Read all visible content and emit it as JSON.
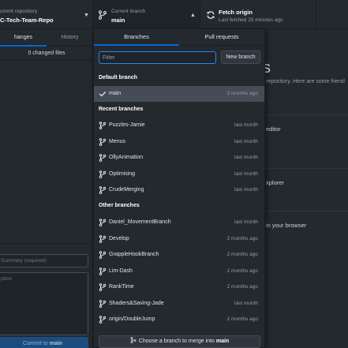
{
  "toolbar": {
    "repo_small": "urrent repository",
    "repo_name": "C-Tech-Team-Repo",
    "branch_small": "Current branch",
    "branch_name": "main",
    "fetch_title": "Fetch origin",
    "fetch_sub": "Last fetched 25 minutes ago"
  },
  "sidebar": {
    "tab_changes": "hanges",
    "tab_history": "History",
    "changed_files": "0 changed files",
    "summary_placeholder": "Summary (required)",
    "description_placeholder": "ption",
    "commit_prefix": "Commit to ",
    "commit_branch": "main"
  },
  "main": {
    "heading": "s",
    "text": "repository. Here are some friend",
    "editor": "editor",
    "explorer": "xplorer",
    "browser": "in your browser"
  },
  "dropdown": {
    "tab_branches": "Branches",
    "tab_pull_requests": "Pull requests",
    "filter_placeholder": "Filter",
    "new_branch_label": "New branch",
    "default_header": "Default branch",
    "default_branch": {
      "name": "main",
      "time": "2 months ago"
    },
    "recent_header": "Recent branches",
    "recent_branches": [
      {
        "name": "Puzzles-Jamie",
        "time": "last month"
      },
      {
        "name": "Menus",
        "time": "last month"
      },
      {
        "name": "OllyAnimation",
        "time": "last month"
      },
      {
        "name": "Optimising",
        "time": "last month"
      },
      {
        "name": "CrudeMerging",
        "time": "last month"
      }
    ],
    "other_header": "Other branches",
    "other_branches": [
      {
        "name": "Daniel_MovementBranch",
        "time": "last month"
      },
      {
        "name": "Develop",
        "time": "2 months ago"
      },
      {
        "name": "GrappleHookBranch",
        "time": "2 months ago"
      },
      {
        "name": "Lim-Dash",
        "time": "2 months ago"
      },
      {
        "name": "RankTime",
        "time": "2 months ago"
      },
      {
        "name": "Shaders&Saving-Jade",
        "time": "last month"
      },
      {
        "name": "origin/DoubleJump",
        "time": "2 months ago"
      }
    ],
    "merge_prefix": "Choose a branch to merge into ",
    "merge_branch": "main"
  },
  "colors": {
    "accent": "#0366d6",
    "background": "#24292e",
    "selected_row": "#444d56",
    "commit_button": "#1d4c7f"
  },
  "icons": [
    "branch-icon",
    "caret-up-icon",
    "caret-down-icon",
    "sync-icon",
    "check-icon",
    "merge-icon"
  ]
}
